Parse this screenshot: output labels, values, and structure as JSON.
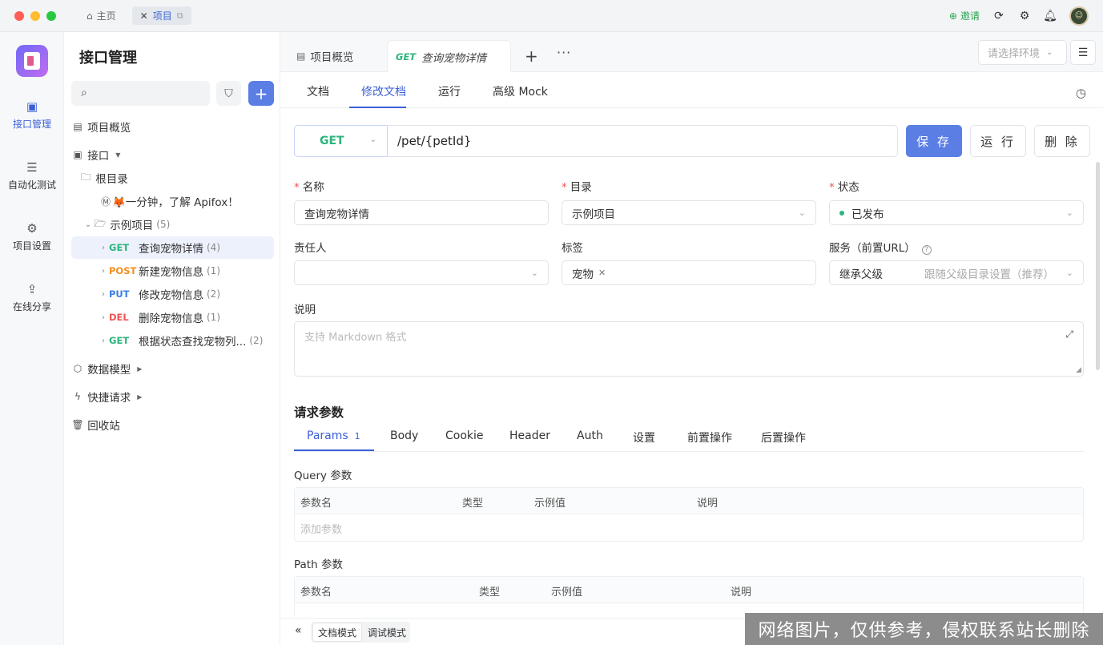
{
  "titlebar": {
    "home_label": "主页",
    "project_tab_label": "项目",
    "invite_label": "邀请"
  },
  "rail": {
    "items": [
      {
        "label": "接口管理",
        "icon": "api-icon"
      },
      {
        "label": "自动化测试",
        "icon": "automation-icon"
      },
      {
        "label": "项目设置",
        "icon": "settings-icon"
      },
      {
        "label": "在线分享",
        "icon": "share-icon"
      }
    ]
  },
  "sidebar": {
    "title": "接口管理",
    "tree": {
      "overview": "项目概览",
      "api": "接口",
      "root_dir": "根目录",
      "intro_doc": "🦊一分钟，了解 Apifox！",
      "example_folder": "示例项目",
      "example_count": "(5)",
      "endpoints": [
        {
          "method": "GET",
          "name": "查询宠物详情",
          "count": "(4)"
        },
        {
          "method": "POST",
          "name": "新建宠物信息",
          "count": "(1)"
        },
        {
          "method": "PUT",
          "name": "修改宠物信息",
          "count": "(2)"
        },
        {
          "method": "DEL",
          "name": "删除宠物信息",
          "count": "(1)"
        },
        {
          "method": "GET",
          "name": "根据状态查找宠物列...",
          "count": "(2)"
        }
      ],
      "data_model": "数据模型",
      "quick_request": "快捷请求",
      "recycle_bin": "回收站"
    }
  },
  "main": {
    "doc_tabs": [
      {
        "label": "项目概览"
      },
      {
        "method": "GET",
        "label": "查询宠物详情"
      }
    ],
    "env_placeholder": "请选择环境",
    "sub_tabs": [
      "文档",
      "修改文档",
      "运行",
      "高级 Mock"
    ],
    "method": "GET",
    "url": "/pet/{petId}",
    "buttons": {
      "save": "保 存",
      "run": "运 行",
      "delete": "删 除"
    },
    "form": {
      "name_label": "名称",
      "name_value": "查询宠物详情",
      "dir_label": "目录",
      "dir_value": "示例项目",
      "status_label": "状态",
      "status_value": "已发布",
      "owner_label": "责任人",
      "tags_label": "标签",
      "tag_value": "宠物",
      "service_label": "服务（前置URL）",
      "service_value": "继承父级",
      "service_hint": "跟随父级目录设置（推荐）",
      "desc_label": "说明",
      "desc_placeholder": "支持 Markdown 格式"
    },
    "request": {
      "title": "请求参数",
      "tabs": [
        {
          "label": "Params",
          "badge": "1"
        },
        {
          "label": "Body"
        },
        {
          "label": "Cookie"
        },
        {
          "label": "Header"
        },
        {
          "label": "Auth"
        },
        {
          "label": "设置"
        },
        {
          "label": "前置操作"
        },
        {
          "label": "后置操作"
        }
      ],
      "query_label": "Query 参数",
      "query_headers": [
        "参数名",
        "类型",
        "示例值",
        "说明"
      ],
      "query_add": "添加参数",
      "path_label": "Path 参数",
      "path_headers": [
        "参数名",
        "类型",
        "示例值",
        "说明"
      ]
    },
    "bottom": {
      "doc_mode": "文档模式",
      "debug_mode": "调试模式"
    }
  },
  "watermark": "网络图片，仅供参考，侵权联系站长删除"
}
